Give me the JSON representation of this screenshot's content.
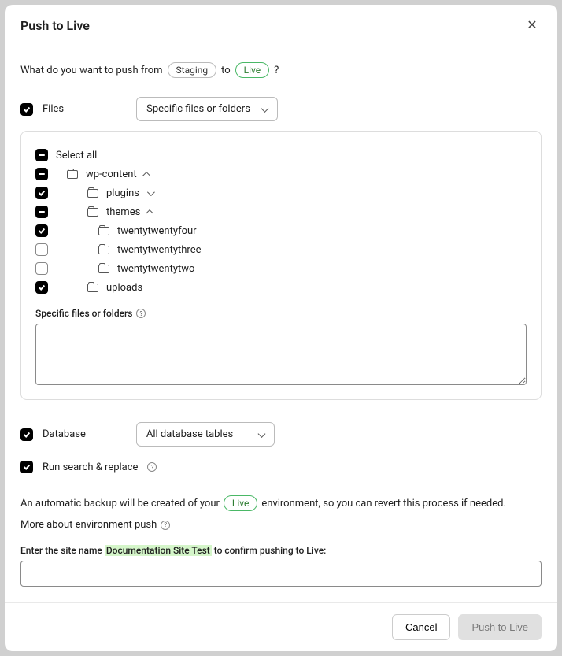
{
  "header": {
    "title": "Push to Live"
  },
  "prompt": {
    "pre": "What do you want to push from",
    "from": "Staging",
    "mid": "to",
    "to": "Live",
    "q": "?"
  },
  "files": {
    "label": "Files",
    "selectValue": "Specific files or folders",
    "selectAll": "Select all",
    "tree": {
      "wpcontent": "wp-content",
      "plugins": "plugins",
      "themes": "themes",
      "twentytwentyfour": "twentytwentyfour",
      "twentytwentythree": "twentytwentythree",
      "twentytwentytwo": "twentytwentytwo",
      "uploads": "uploads"
    },
    "specificLabel": "Specific files or folders"
  },
  "database": {
    "label": "Database",
    "selectValue": "All database tables"
  },
  "searchReplace": {
    "label": "Run search & replace"
  },
  "backup": {
    "pre": "An automatic backup will be created of your",
    "env": "Live",
    "post": "environment, so you can revert this process if needed."
  },
  "moreLink": "More about environment push",
  "confirm": {
    "pre": "Enter the site name",
    "siteName": "Documentation Site Test",
    "post": "to confirm pushing to Live:"
  },
  "footer": {
    "cancel": "Cancel",
    "push": "Push to Live"
  }
}
